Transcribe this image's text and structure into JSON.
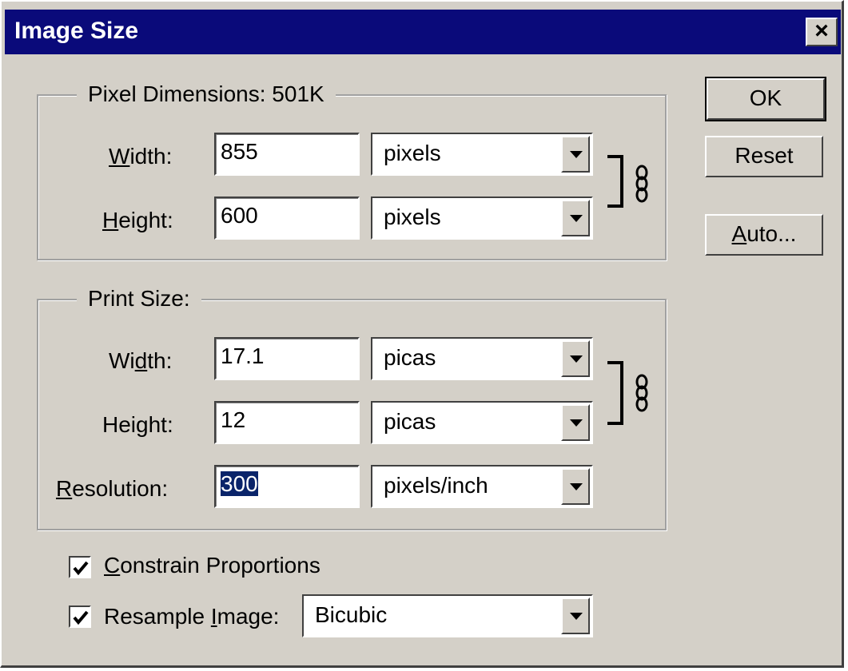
{
  "window": {
    "title": "Image Size",
    "close_glyph": "×"
  },
  "buttons": {
    "ok": "OK",
    "reset": "Reset",
    "auto": "Auto..."
  },
  "pixel_dimensions": {
    "legend": "Pixel Dimensions:  501K",
    "width_label": "Width:",
    "width_value": "855",
    "width_unit": "pixels",
    "height_label": "Height:",
    "height_value": "600",
    "height_unit": "pixels"
  },
  "print_size": {
    "legend": "Print Size:",
    "width_label": "Width:",
    "width_value": "17.1",
    "width_unit": "picas",
    "height_label": "Height:",
    "height_value": "12",
    "height_unit": "picas",
    "resolution_label": "Resolution:",
    "resolution_value": "300",
    "resolution_unit": "pixels/inch"
  },
  "options": {
    "constrain_label": "Constrain Proportions",
    "constrain_checked": true,
    "resample_label": "Resample Image:",
    "resample_checked": true,
    "resample_method": "Bicubic"
  },
  "icons": {
    "link": "chain-link-icon",
    "dropdown": "chevron-down-icon",
    "check": "checkmark-icon"
  }
}
